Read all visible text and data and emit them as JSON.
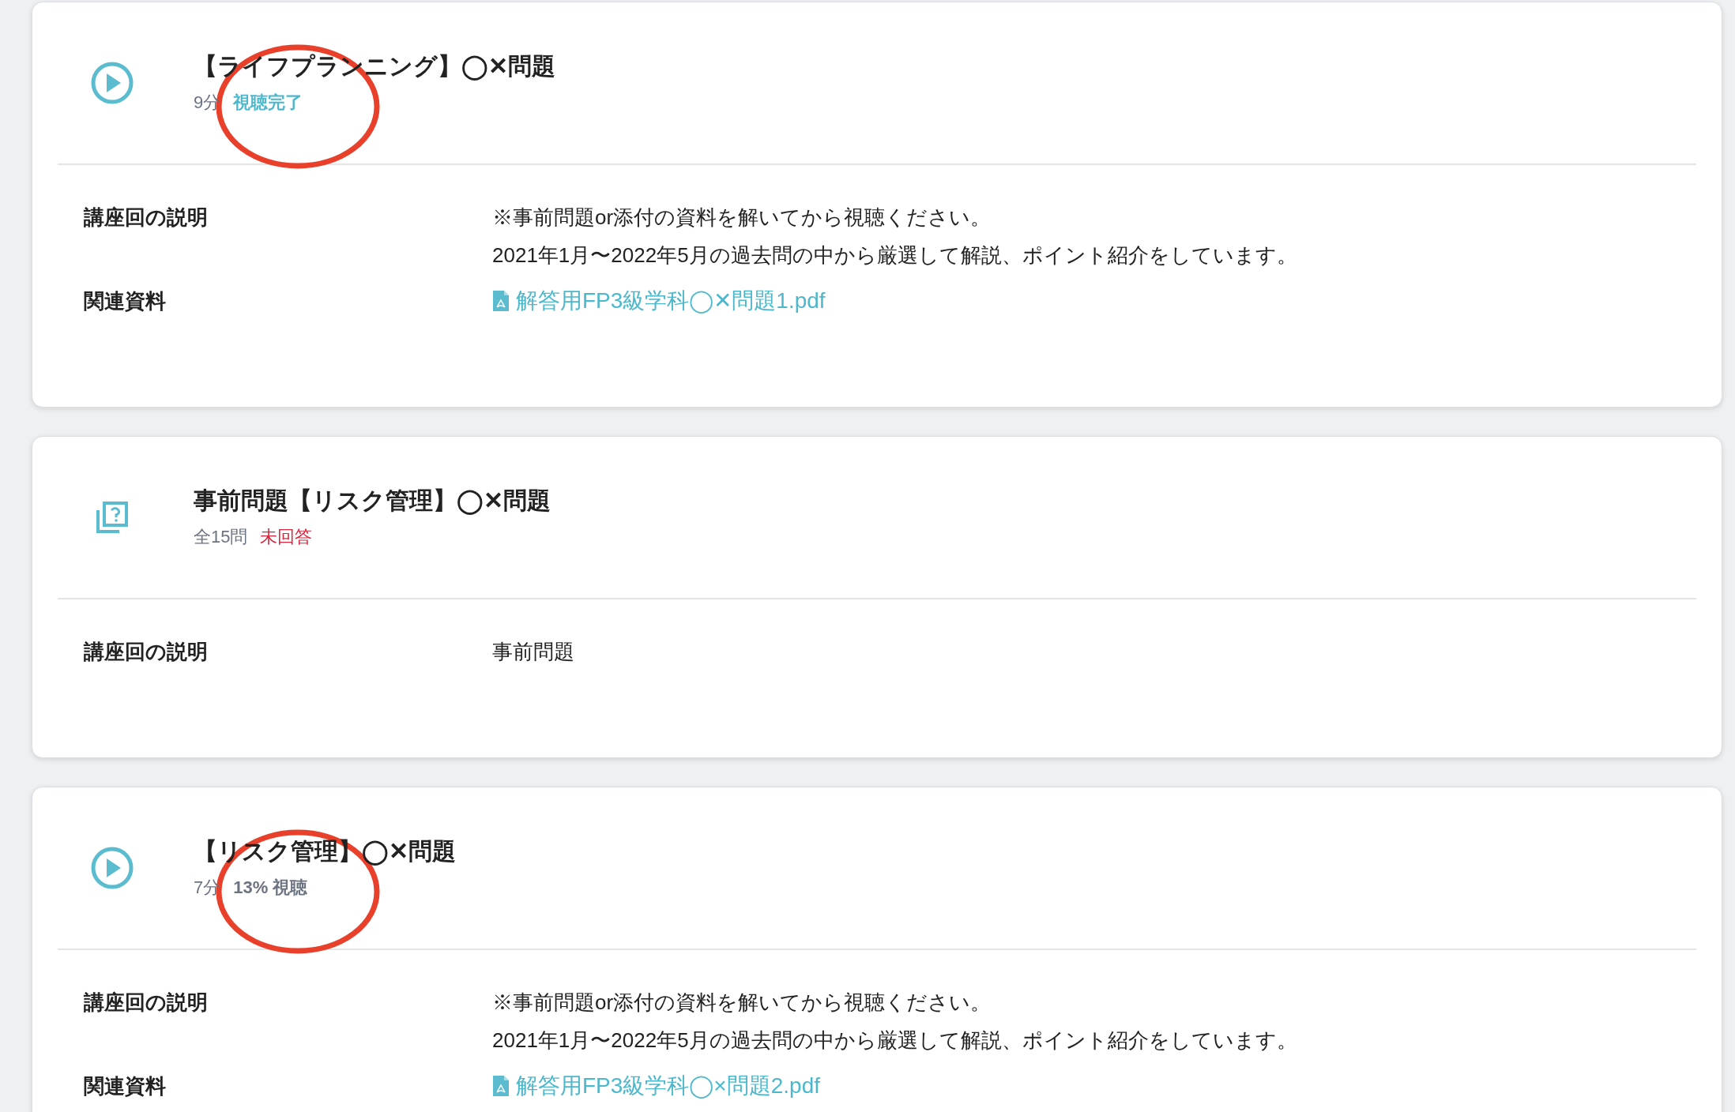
{
  "lectures": [
    {
      "kind": "video",
      "title": "【ライフプランニング】◯✕問題",
      "meta": "9分",
      "status": {
        "kind": "complete",
        "text": "視聴完了"
      },
      "annotated": true,
      "details": [
        {
          "label": "講座回の説明",
          "lines": [
            "※事前問題or添付の資料を解いてから視聴ください。",
            "2021年1月〜2022年5月の過去問の中から厳選して解説、ポイント紹介をしています。"
          ]
        },
        {
          "label": "関連資料",
          "file": "解答用FP3級学科◯✕問題1.pdf"
        }
      ]
    },
    {
      "kind": "quiz",
      "title": "事前問題【リスク管理】◯✕問題",
      "meta": "全15問",
      "status": {
        "kind": "unanswered",
        "text": "未回答"
      },
      "annotated": false,
      "details": [
        {
          "label": "講座回の説明",
          "lines": [
            "事前問題"
          ]
        }
      ]
    },
    {
      "kind": "video",
      "title": "【リスク管理】◯✕問題",
      "meta": "7分",
      "status": {
        "kind": "progress",
        "text": "13% 視聴"
      },
      "annotated": true,
      "details": [
        {
          "label": "講座回の説明",
          "lines": [
            "※事前問題or添付の資料を解いてから視聴ください。",
            "2021年1月〜2022年5月の過去問の中から厳選して解説、ポイント紹介をしています。"
          ]
        },
        {
          "label": "関連資料",
          "file": "解答用FP3級学科◯×問題2.pdf"
        }
      ]
    }
  ]
}
